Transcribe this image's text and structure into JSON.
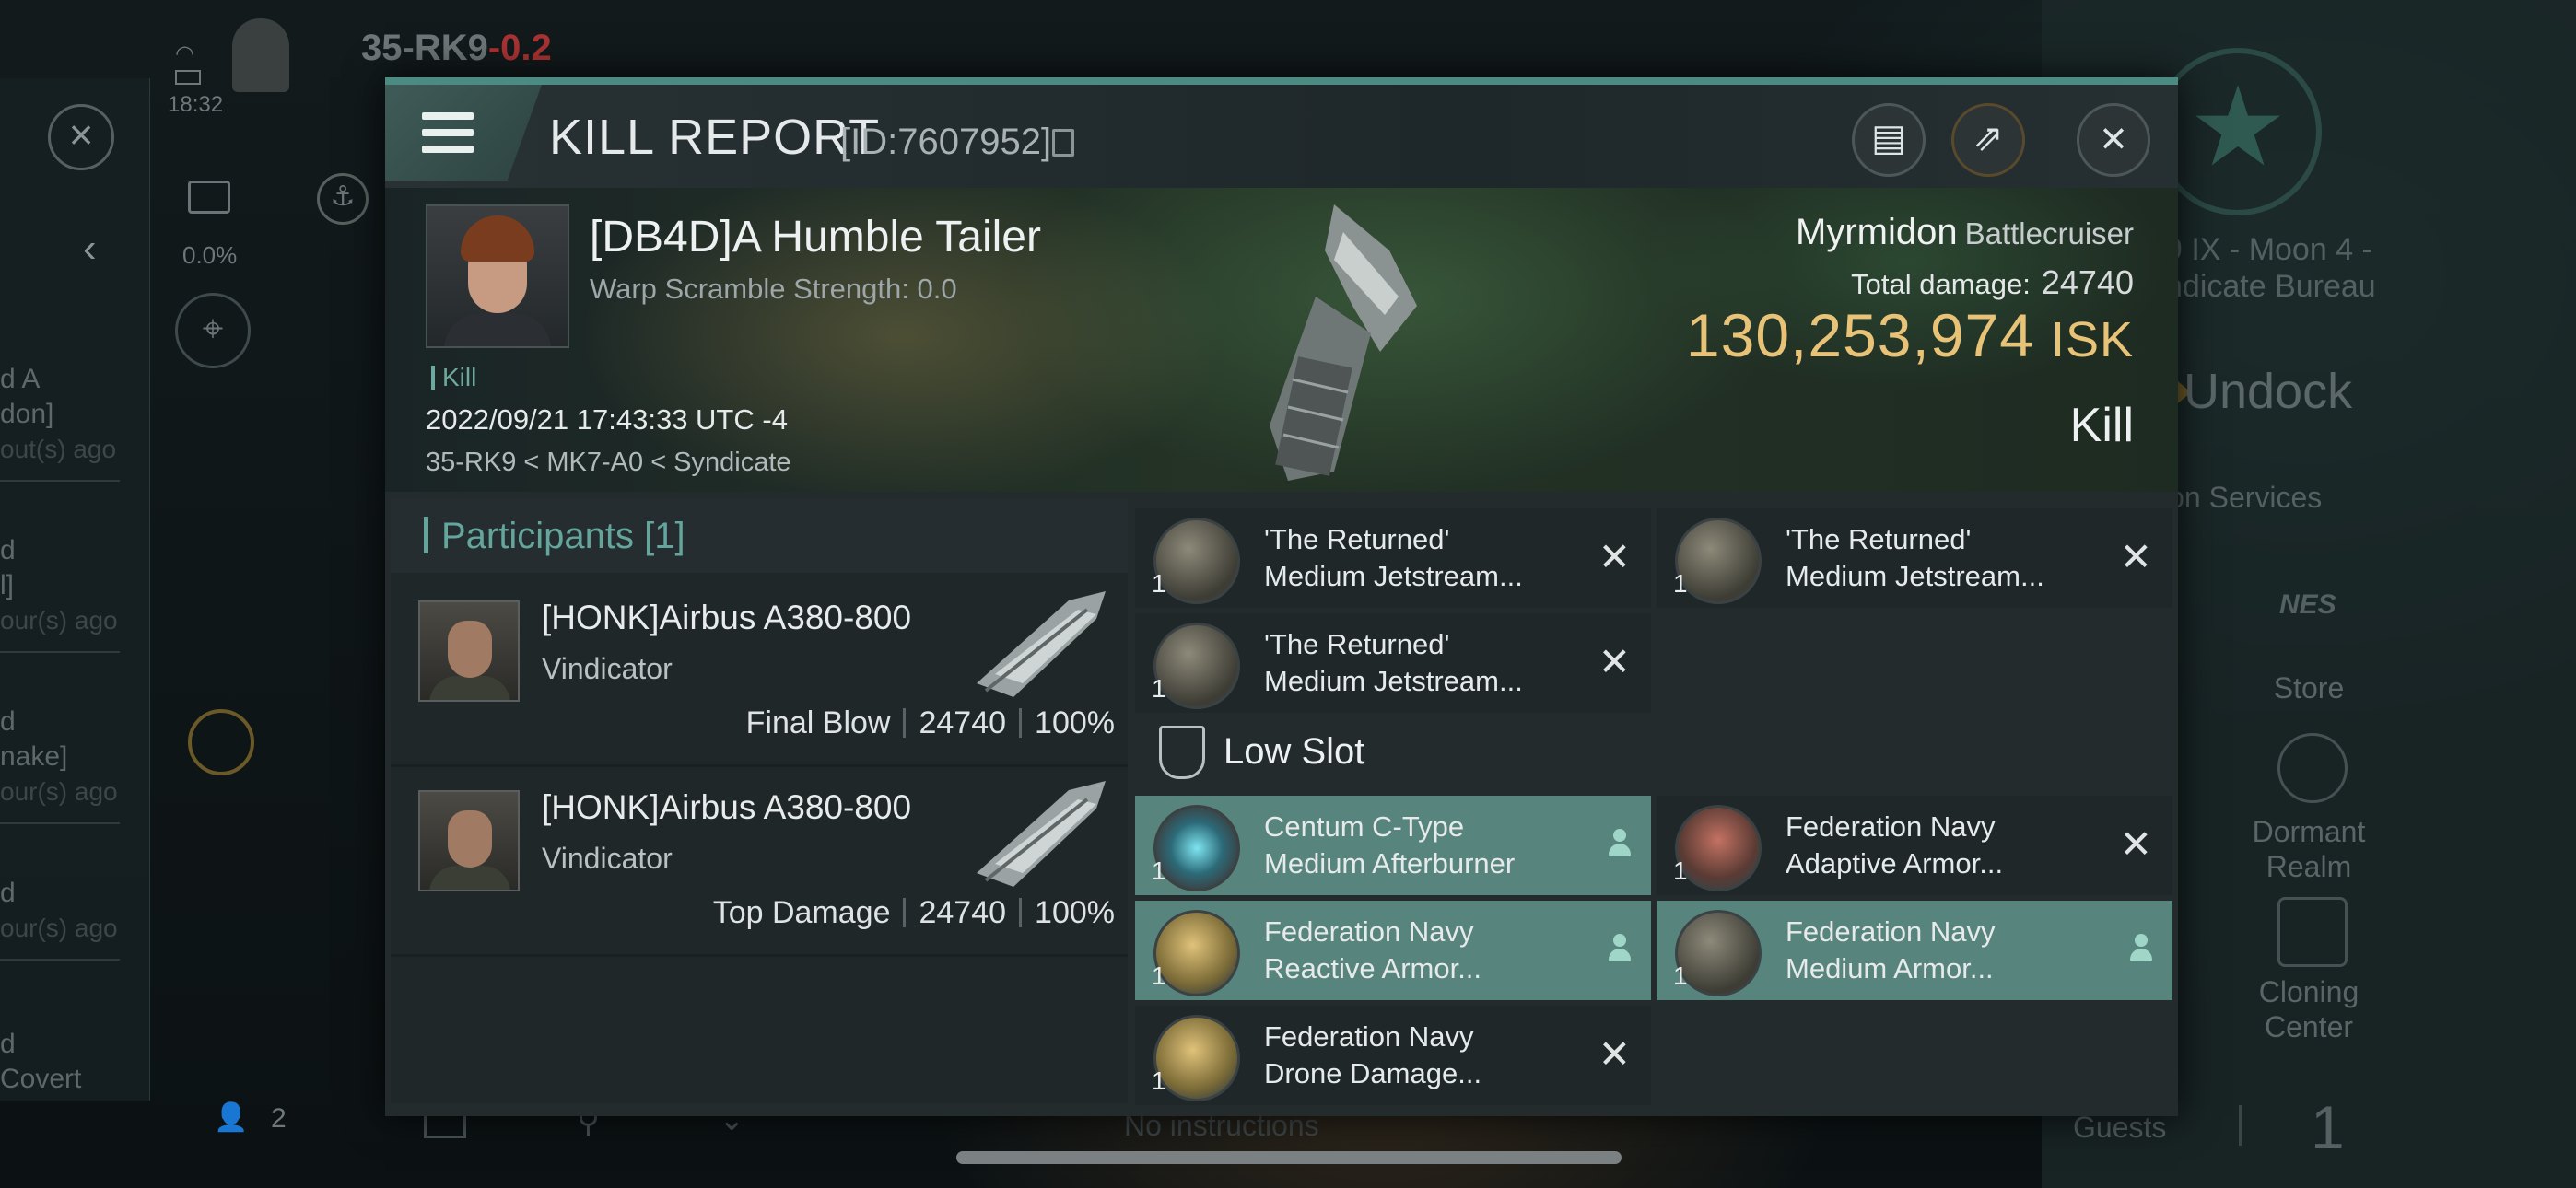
{
  "hud": {
    "clock": "18:32",
    "system_name": "35-RK9",
    "security": "-0.2",
    "security_color": "#c23a3a",
    "percent": "0.0%",
    "chat_count": "2",
    "guests_label": "Guests",
    "guests_count": "1",
    "station_name_1": "9 IX - Moon 4 -",
    "station_name_2": "ndicate Bureau",
    "undock_label": "Undock",
    "services_label": "ion Services",
    "store_label": "Store",
    "dormant_label_1": "Dormant",
    "dormant_label_2": "Realm",
    "cloning_label_1": "Cloning",
    "cloning_label_2": "Center",
    "nes_label": "NES",
    "bottom_hint": "No instructions"
  },
  "left_panel": {
    "items": [
      {
        "line1": "d A",
        "line2": "don]",
        "sub": "out(s) ago"
      },
      {
        "line1": "d",
        "line2": "l]",
        "sub": "our(s) ago"
      },
      {
        "line1": "d",
        "line2": "nake]",
        "sub": "our(s) ago"
      },
      {
        "line1": "d",
        "line2": "",
        "sub": "our(s) ago"
      },
      {
        "line1": "d",
        "line2": "Covert",
        "sub": ""
      }
    ]
  },
  "report": {
    "title": "KILL REPORT",
    "id": "[ID:7607952]",
    "victim_name": "[DB4D]A Humble Tailer",
    "warp_scramble": "Warp Scramble Strength: 0.0",
    "kill_tag": "Kill",
    "timestamp": "2022/09/21 17:43:33 UTC -4",
    "location": "35-RK9 < MK7-A0 < Syndicate",
    "ship_name": "Myrmidon",
    "ship_class": "Battlecruiser",
    "total_damage_label": "Total damage:",
    "total_damage": "24740",
    "isk_value": "130,253,974",
    "isk_unit": "ISK",
    "result": "Kill"
  },
  "participants": {
    "title": "Participants [1]",
    "rows": [
      {
        "name": "[HONK]Airbus A380-800",
        "ship": "Vindicator",
        "label": "Final Blow",
        "damage": "24740",
        "percent": "100%"
      },
      {
        "name": "[HONK]Airbus A380-800",
        "ship": "Vindicator",
        "label": "Top Damage",
        "damage": "24740",
        "percent": "100%"
      }
    ]
  },
  "modules": {
    "mid": [
      {
        "qty": "1",
        "line1": "'The Returned'",
        "line2": "Medium Jetstream...",
        "state": "destroyed"
      },
      {
        "qty": "1",
        "line1": "'The Returned'",
        "line2": "Medium Jetstream...",
        "state": "destroyed"
      },
      {
        "qty": "1",
        "line1": "'The Returned'",
        "line2": "Medium Jetstream...",
        "state": "destroyed"
      }
    ],
    "low_slot_title": "Low Slot",
    "low": [
      {
        "qty": "1",
        "line1": "Centum C-Type",
        "line2": "Medium Afterburner",
        "state": "dropped"
      },
      {
        "qty": "1",
        "line1": "Federation Navy",
        "line2": "Adaptive Armor...",
        "state": "destroyed"
      },
      {
        "qty": "1",
        "line1": "Federation Navy",
        "line2": "Reactive Armor...",
        "state": "dropped"
      },
      {
        "qty": "1",
        "line1": "Federation Navy",
        "line2": "Medium Armor...",
        "state": "dropped"
      },
      {
        "qty": "1",
        "line1": "Federation Navy",
        "line2": "Drone Damage...",
        "state": "destroyed"
      }
    ]
  },
  "colors": {
    "accent": "#4c8b82",
    "dropped_highlight": "#57857d",
    "isk_gold": "#e8c276"
  }
}
